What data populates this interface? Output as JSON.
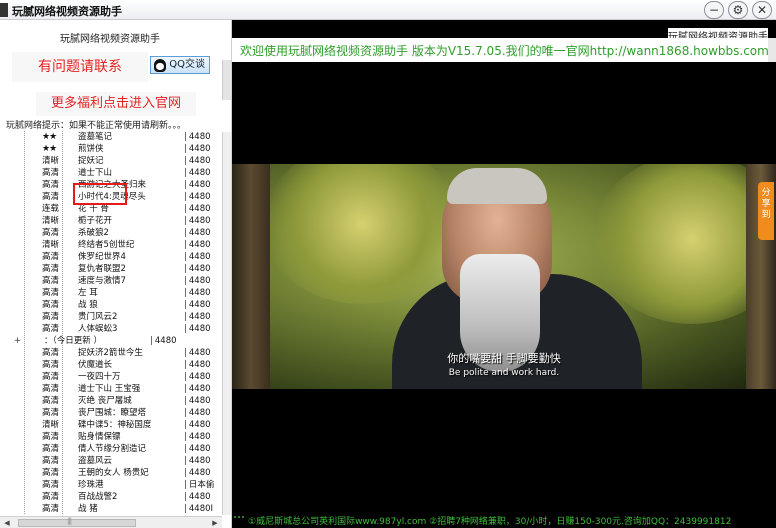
{
  "window": {
    "title": "玩腻网络视频资源助手",
    "controls": [
      "−",
      "⚙",
      "✕"
    ]
  },
  "sidebar": {
    "title": "玩腻网络视频资源助手",
    "help_text": "有问题请联系",
    "qq_label": "QQ交谈",
    "welfare_text": "更多福利点击进入官网",
    "notice": "玩腻网络提示：如果不能正常使用请刷新。。。"
  },
  "tree": {
    "rows": [
      {
        "tag": "★★",
        "title": "盗墓笔记",
        "count": "4480"
      },
      {
        "tag": "★★",
        "title": "煎饼侠",
        "count": "4480"
      },
      {
        "tag": "清晰",
        "title": "捉妖记",
        "count": "4480"
      },
      {
        "tag": "高清",
        "title": "道士下山",
        "count": "4480"
      },
      {
        "tag": "高清",
        "title": "西游记之大圣归来",
        "count": "4480"
      },
      {
        "tag": "高清",
        "title": "小时代4:灵魂尽头",
        "count": "4480"
      },
      {
        "tag": "连载",
        "title": "花 千 骨",
        "count": "4480"
      },
      {
        "tag": "清晰",
        "title": "栀子花开",
        "count": "4480"
      },
      {
        "tag": "高清",
        "title": "杀破狼2",
        "count": "4480"
      },
      {
        "tag": "清晰",
        "title": "终结者5创世纪",
        "count": "4480"
      },
      {
        "tag": "高清",
        "title": "侏罗纪世界4",
        "count": "4480"
      },
      {
        "tag": "高清",
        "title": "复仇者联盟2",
        "count": "4480"
      },
      {
        "tag": "高清",
        "title": "速度与激情7",
        "count": "4480"
      },
      {
        "tag": "高清",
        "title": "左    耳",
        "count": "4480"
      },
      {
        "tag": "高清",
        "title": "战    狼",
        "count": "4480"
      },
      {
        "tag": "高清",
        "title": "贵门风云2",
        "count": "4480"
      },
      {
        "tag": "高清",
        "title": "人体蜈蚣3",
        "count": "4480"
      }
    ],
    "category": {
      "label": "：（今日更新 ）",
      "count": "4480"
    },
    "rows2": [
      {
        "tag": "高清",
        "title": "捉妖济2箭世今生",
        "count": "4480"
      },
      {
        "tag": "高清",
        "title": "伏魔道长",
        "count": "4480"
      },
      {
        "tag": "高清",
        "title": "一夜四十万",
        "count": "4480"
      },
      {
        "tag": "高清",
        "title": "道士下山 王宝强",
        "count": "4480"
      },
      {
        "tag": "高清",
        "title": "灭绝 丧尸屠城",
        "count": "4480"
      },
      {
        "tag": "高清",
        "title": "丧尸围城：瞭望塔",
        "count": "4480"
      },
      {
        "tag": "清晰",
        "title": "碟中谍5：神秘国度",
        "count": "4480"
      },
      {
        "tag": "高清",
        "title": "贴身情保镖",
        "count": "4480"
      },
      {
        "tag": "高清",
        "title": "倩人节缘分割造记",
        "count": "4480"
      },
      {
        "tag": "高清",
        "title": "盗墓风云",
        "count": "4480"
      },
      {
        "tag": "高清",
        "title": "王朝的女人 杨贵妃",
        "count": "4480"
      },
      {
        "tag": "高清",
        "title": "珍珠港",
        "count": "日本偷"
      },
      {
        "tag": "高清",
        "title": "百战战警2",
        "count": "4480"
      },
      {
        "tag": "高清",
        "title": "战    猪",
        "count": "4480I"
      }
    ]
  },
  "main": {
    "site_title": "玩腻网络视频资源助手",
    "banner": "欢迎使用玩腻网络视频资源助手  版本为V15.7.05.我们的唯一官网http://wann1868.howbbs.com/!",
    "subtitle_cn": "你的嘴要甜  手脚要勤快",
    "subtitle_en": "Be polite and work hard.",
    "share_label": "分享到",
    "bottom_ticker": "①威尼斯城总公司英利国际www.987yl.com  ②招聘7种网络兼职，30/小时，日赚150-300元.咨询加QQ：2439991812"
  },
  "colors": {
    "accent_red": "#e52222",
    "banner_green": "#2e9e2a",
    "share_orange": "#f08c1e"
  }
}
